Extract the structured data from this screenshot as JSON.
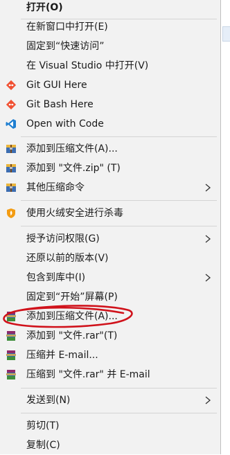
{
  "context_menu": {
    "items": [
      {
        "label": "打开(O)",
        "icon": null
      },
      {
        "label": "在新窗口中打开(E)",
        "icon": null
      },
      {
        "label": "固定到“快速访问”",
        "icon": null
      },
      {
        "label": "在 Visual Studio 中打开(V)",
        "icon": null
      },
      {
        "label": "Git GUI Here",
        "icon": "git-icon"
      },
      {
        "label": "Git Bash Here",
        "icon": "git-icon"
      },
      {
        "label": "Open with Code",
        "icon": "vscode-icon"
      },
      {
        "label": "添加到压缩文件(A)...",
        "icon": "archive-icon"
      },
      {
        "label": "添加到 \"文件.zip\" (T)",
        "icon": "archive-icon"
      },
      {
        "label": "其他压缩命令",
        "icon": "archive-icon",
        "submenu": true
      },
      {
        "label": "使用火绒安全进行杀毒",
        "icon": "huorong-shield-icon"
      },
      {
        "label": "授予访问权限(G)",
        "icon": null,
        "submenu": true
      },
      {
        "label": "还原以前的版本(V)",
        "icon": null
      },
      {
        "label": "包含到库中(I)",
        "icon": null,
        "submenu": true
      },
      {
        "label": "固定到“开始”屏幕(P)",
        "icon": null
      },
      {
        "label": "添加到压缩文件(A)...",
        "icon": "winrar-icon",
        "highlighted_by_annotation": true
      },
      {
        "label": "添加到 \"文件.rar\"(T)",
        "icon": "winrar-icon"
      },
      {
        "label": "压缩并 E-mail...",
        "icon": "winrar-icon"
      },
      {
        "label": "压缩到 \"文件.rar\" 并 E-mail",
        "icon": "winrar-icon"
      },
      {
        "label": "发送到(N)",
        "icon": null,
        "submenu": true
      },
      {
        "label": "剪切(T)",
        "icon": null
      },
      {
        "label": "复制(C)",
        "icon": null
      }
    ]
  },
  "colors": {
    "menu_bg": "#f2f2f2",
    "annotation_red": "#d0121b",
    "git_orange": "#f05133",
    "vscode_blue": "#1f7fd1"
  }
}
